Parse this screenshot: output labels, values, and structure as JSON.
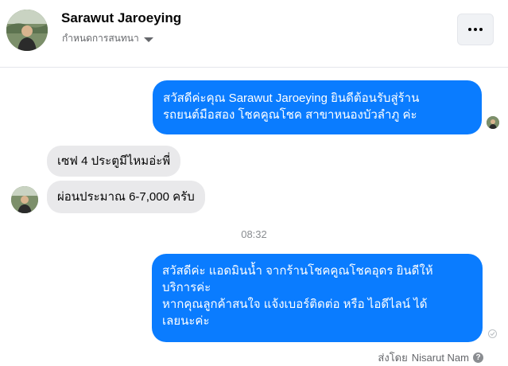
{
  "header": {
    "name": "Sarawut Jaroeying",
    "subtitle": "กำหนดการสนทนา",
    "avatar_icon": "profile-photo",
    "more_icon": "more-horizontal-icon"
  },
  "messages": [
    {
      "direction": "outgoing",
      "lines": [
        "สวัสดีค่ะคุณ Sarawut Jaroeying ยินดีต้อนรับสู่ร้าน",
        "รถยนต์มือสอง โชคคูณโชค สาขาหนองบัวลำภู ค่ะ"
      ]
    },
    {
      "direction": "incoming",
      "text": "เซฟ 4 ประตูมีไหมอ่ะพี่"
    },
    {
      "direction": "incoming",
      "text": "ผ่อนประมาณ 6-7,000 ครับ"
    },
    {
      "direction": "outgoing",
      "lines": [
        "สวัสดีค่ะ แอดมินน้ำ จากร้านโชคคูณโชคอุดร ยินดีให้",
        "บริการค่ะ",
        "หากคุณลูกค้าสนใจ แจ้งเบอร์ติดต่อ หรือ ไอดีไลน์ ได้",
        "เลยนะค่ะ"
      ]
    }
  ],
  "timestamp": "08:32",
  "footer": {
    "sent_by_label": "ส่งโดย",
    "sender_name": "Nisarut Nam",
    "help_glyph": "?"
  },
  "colors": {
    "outgoing_bubble": "#0a7cff",
    "incoming_bubble": "#e9e9eb"
  }
}
